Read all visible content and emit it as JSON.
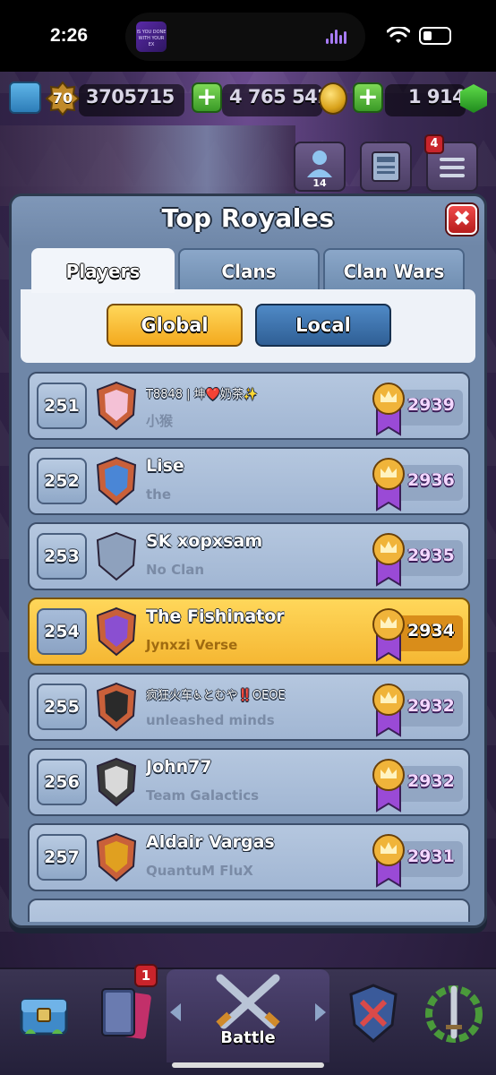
{
  "status_bar": {
    "time": "2:26",
    "island_thumb_text": "IS YOU DONE WITH YOUR EX"
  },
  "resources": {
    "king_level": "70",
    "trophies": "3705715",
    "gold": "4 765 542",
    "gems": "1 914"
  },
  "top_buttons": {
    "friends_count": "14",
    "menu_notifications": "4"
  },
  "modal": {
    "title": "Top Royales",
    "close_label": "✖",
    "tabs": [
      {
        "label": "Players",
        "active": true
      },
      {
        "label": "Clans",
        "active": false
      },
      {
        "label": "Clan Wars",
        "active": false
      }
    ],
    "filters": {
      "global_label": "Global",
      "local_label": "Local",
      "selected": "Global"
    }
  },
  "rows": [
    {
      "rank": "251",
      "name": "T8848 | 坤❤️奶茶✨",
      "clan": "小猴",
      "trophies": "2939",
      "badge_color": "#c9603a",
      "badge_inner": "#f4c1d6",
      "small_name": true
    },
    {
      "rank": "252",
      "name": "Lise",
      "clan": "the",
      "trophies": "2936",
      "badge_color": "#c9603a",
      "badge_inner": "#4a86d6"
    },
    {
      "rank": "253",
      "name": "SK xopxsam",
      "clan": "No Clan",
      "trophies": "2935",
      "badge_color": "#8ea1bd",
      "badge_inner": "#8ea1bd"
    },
    {
      "rank": "254",
      "name": "The Fishinator",
      "clan": "Jynxzi Verse",
      "trophies": "2934",
      "badge_color": "#c9603a",
      "badge_inner": "#8a4fd1",
      "highlight": true
    },
    {
      "rank": "255",
      "name": "疯狂火车♿とむや‼️OEOE",
      "clan": "unleashed minds",
      "trophies": "2932",
      "badge_color": "#c9603a",
      "badge_inner": "#2a2a2a",
      "small_name": true
    },
    {
      "rank": "256",
      "name": "John77",
      "clan": "Team Galactics",
      "trophies": "2932",
      "badge_color": "#3a3a3a",
      "badge_inner": "#d9d9d9"
    },
    {
      "rank": "257",
      "name": "Aldair Vargas",
      "clan": "QuantuM FluX",
      "trophies": "2931",
      "badge_color": "#c9603a",
      "badge_inner": "#e0a020"
    }
  ],
  "bottom_nav": {
    "battle_label": "Battle",
    "cards_notifications": "1"
  },
  "colors": {
    "accent_gold": "#f3a91e",
    "accent_blue": "#2f5f95",
    "highlight_row": "#ffd75a"
  }
}
